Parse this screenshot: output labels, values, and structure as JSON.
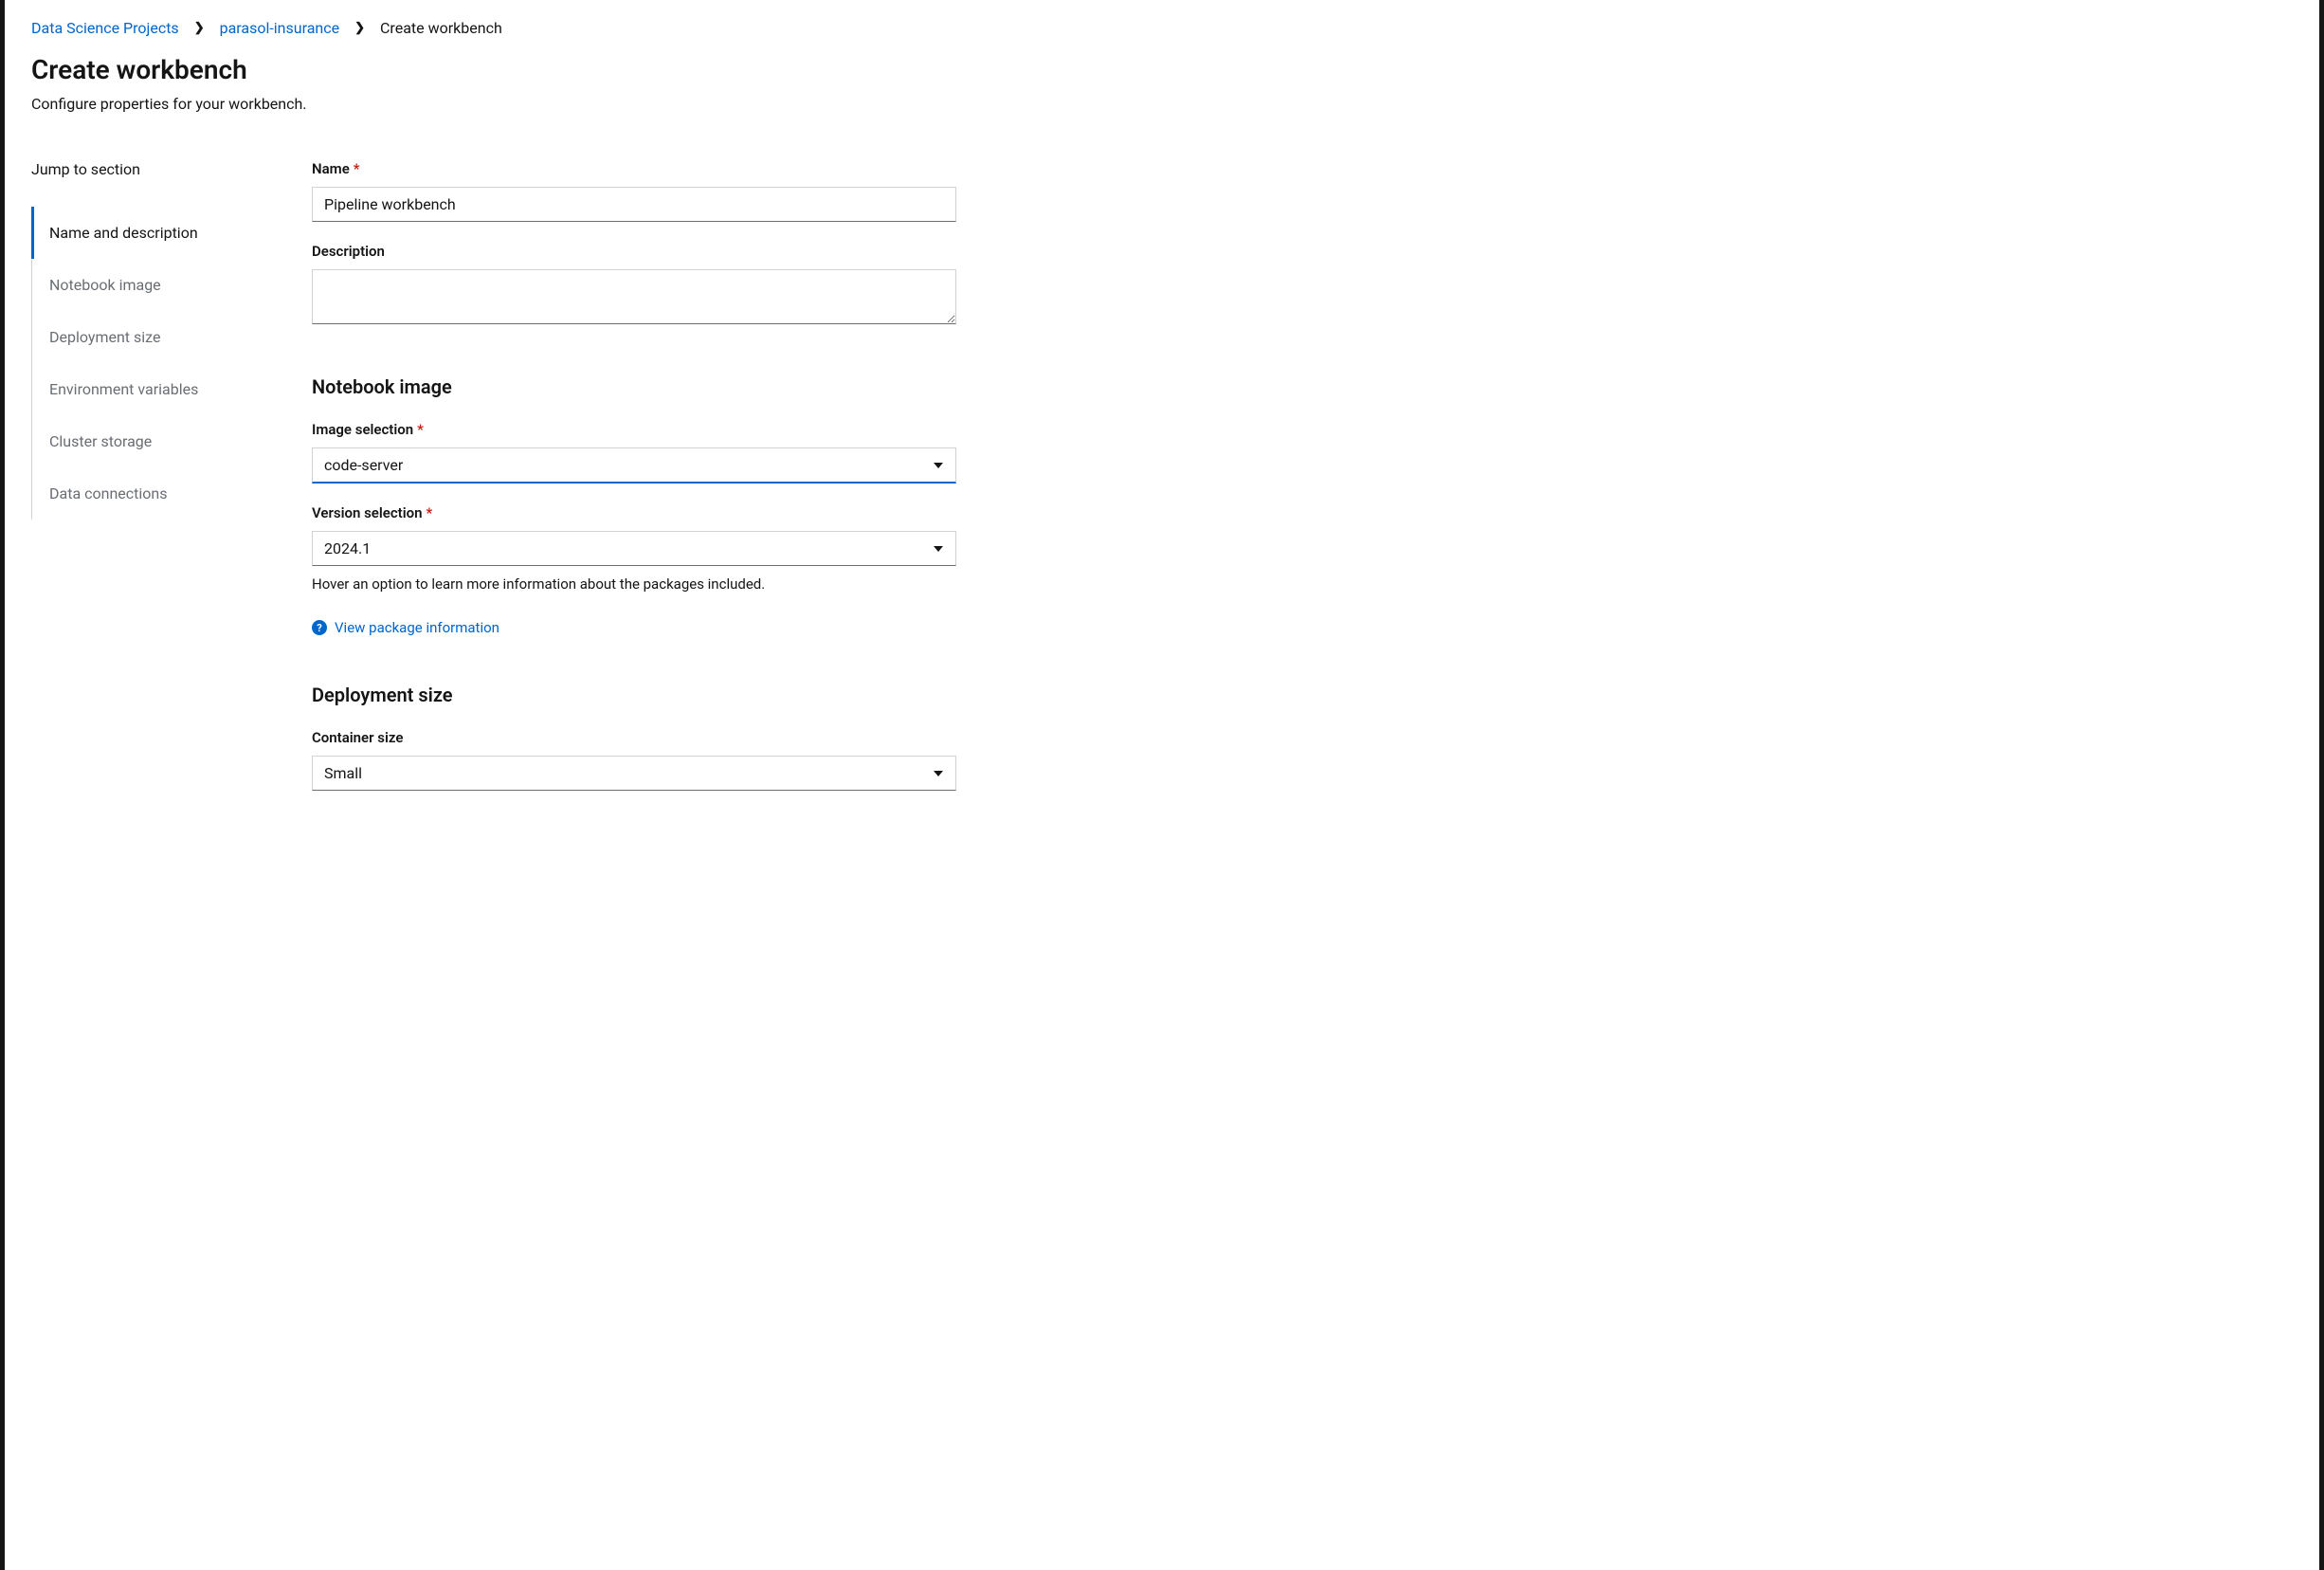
{
  "breadcrumb": {
    "root": "Data Science Projects",
    "project": "parasol-insurance",
    "current": "Create workbench"
  },
  "header": {
    "title": "Create workbench",
    "subtitle": "Configure properties for your workbench."
  },
  "sidebar": {
    "heading": "Jump to section",
    "items": [
      {
        "label": "Name and description",
        "active": true
      },
      {
        "label": "Notebook image",
        "active": false
      },
      {
        "label": "Deployment size",
        "active": false
      },
      {
        "label": "Environment variables",
        "active": false
      },
      {
        "label": "Cluster storage",
        "active": false
      },
      {
        "label": "Data connections",
        "active": false
      }
    ]
  },
  "form": {
    "name": {
      "label": "Name",
      "value": "Pipeline workbench"
    },
    "description": {
      "label": "Description",
      "value": ""
    },
    "notebook_image": {
      "section_title": "Notebook image",
      "image_selection": {
        "label": "Image selection",
        "value": "code-server"
      },
      "version_selection": {
        "label": "Version selection",
        "value": "2024.1",
        "help": "Hover an option to learn more information about the packages included."
      },
      "package_link": "View package information"
    },
    "deployment_size": {
      "section_title": "Deployment size",
      "container_size": {
        "label": "Container size",
        "value": "Small"
      }
    }
  }
}
